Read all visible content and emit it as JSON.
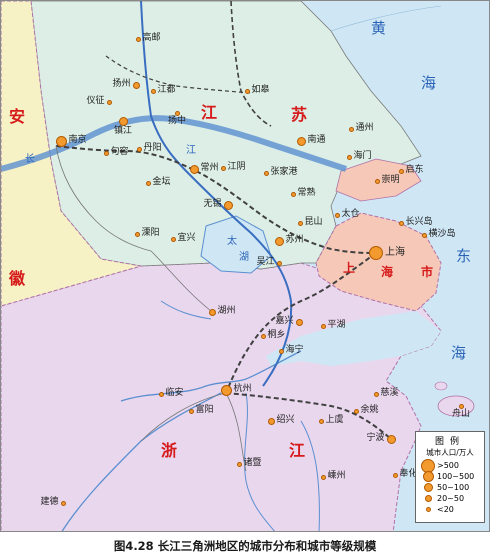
{
  "caption": "图4.28  长江三角洲地区的城市分布和城市等级规模",
  "regions": {
    "anhui": "安",
    "hui": "徽",
    "jiang": "江",
    "su": "苏",
    "zhe": "浙",
    "jiang2": "江",
    "shang": "上",
    "hai": "海",
    "shi": "市"
  },
  "seas": {
    "huang": "黄",
    "hai1": "海",
    "dong": "东",
    "hai2": "海"
  },
  "rivers": {
    "chang": "长",
    "jiang": "江",
    "tai": "太",
    "hu": "湖"
  },
  "cities": [
    {
      "name": "高邮",
      "size": 1
    },
    {
      "name": "扬州",
      "size": 2
    },
    {
      "name": "江都",
      "size": 1
    },
    {
      "name": "仪征",
      "size": 1
    },
    {
      "name": "如皋",
      "size": 1
    },
    {
      "name": "扬中",
      "size": 1
    },
    {
      "name": "南京",
      "size": 4
    },
    {
      "name": "镇江",
      "size": 3
    },
    {
      "name": "南通",
      "size": 3
    },
    {
      "name": "通州",
      "size": 1
    },
    {
      "name": "海门",
      "size": 1
    },
    {
      "name": "句容",
      "size": 1
    },
    {
      "name": "丹阳",
      "size": 1
    },
    {
      "name": "常州",
      "size": 3
    },
    {
      "name": "江阴",
      "size": 1
    },
    {
      "name": "张家港",
      "size": 1
    },
    {
      "name": "启东",
      "size": 1
    },
    {
      "name": "金坛",
      "size": 1
    },
    {
      "name": "常熟",
      "size": 1
    },
    {
      "name": "崇明",
      "size": 1
    },
    {
      "name": "太仓",
      "size": 1
    },
    {
      "name": "无锡",
      "size": 3
    },
    {
      "name": "昆山",
      "size": 1
    },
    {
      "name": "长兴岛",
      "size": 1
    },
    {
      "name": "横沙岛",
      "size": 1
    },
    {
      "name": "溧阳",
      "size": 1
    },
    {
      "name": "宜兴",
      "size": 1
    },
    {
      "name": "苏州",
      "size": 3
    },
    {
      "name": "上海",
      "size": 5
    },
    {
      "name": "吴江",
      "size": 1
    },
    {
      "name": "湖州",
      "size": 2
    },
    {
      "name": "嘉兴",
      "size": 2
    },
    {
      "name": "平湖",
      "size": 1
    },
    {
      "name": "桐乡",
      "size": 1
    },
    {
      "name": "海宁",
      "size": 1
    },
    {
      "name": "临安",
      "size": 1
    },
    {
      "name": "杭州",
      "size": 4
    },
    {
      "name": "慈溪",
      "size": 1
    },
    {
      "name": "余姚",
      "size": 1
    },
    {
      "name": "富阳",
      "size": 1
    },
    {
      "name": "绍兴",
      "size": 2
    },
    {
      "name": "舟山",
      "size": 1
    },
    {
      "name": "上虞",
      "size": 1
    },
    {
      "name": "宁波",
      "size": 3
    },
    {
      "name": "诸暨",
      "size": 1
    },
    {
      "name": "嵊州",
      "size": 1
    },
    {
      "name": "奉化",
      "size": 1
    },
    {
      "name": "建德",
      "size": 1
    }
  ],
  "legend": {
    "title": "图例",
    "unit": "城市人口/万人",
    "items": [
      {
        "label": ">500",
        "size": 5
      },
      {
        "label": "100~500",
        "size": 4
      },
      {
        "label": "50~100",
        "size": 3
      },
      {
        "label": "20~50",
        "size": 2
      },
      {
        "label": "<20",
        "size": 1
      }
    ]
  },
  "colors": {
    "sea": "#cfe7f5",
    "jiangsu": "#dceee6",
    "anhui": "#f6f2c6",
    "zhejiang": "#e9d7ee",
    "shanghai": "#f6c8b8",
    "river": "#5b8fd0",
    "canal": "#3a6ec0",
    "rail": "#404040",
    "city": "#f29a2e"
  }
}
